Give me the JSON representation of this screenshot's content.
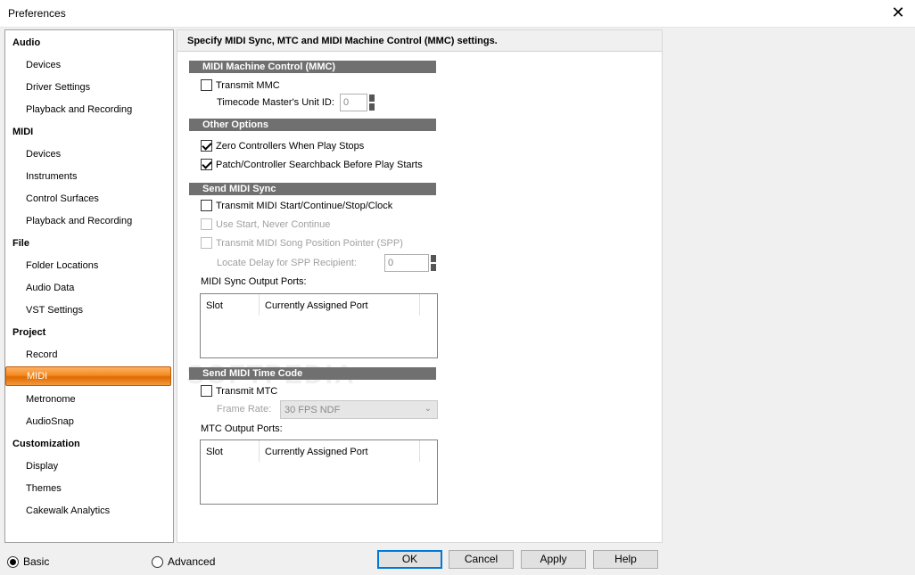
{
  "window": {
    "title": "Preferences",
    "close_glyph": "✕"
  },
  "sidebar": {
    "categories": [
      {
        "label": "Audio",
        "items": [
          "Devices",
          "Driver Settings",
          "Playback and Recording"
        ]
      },
      {
        "label": "MIDI",
        "items": [
          "Devices",
          "Instruments",
          "Control Surfaces",
          "Playback and Recording"
        ]
      },
      {
        "label": "File",
        "items": [
          "Folder Locations",
          "Audio Data",
          "VST Settings"
        ]
      },
      {
        "label": "Project",
        "items": [
          "Record",
          "MIDI",
          "Metronome",
          "AudioSnap"
        ]
      },
      {
        "label": "Customization",
        "items": [
          "Display",
          "Themes",
          "Cakewalk Analytics"
        ]
      }
    ],
    "active": "Project/MIDI"
  },
  "panel": {
    "header": "Specify MIDI Sync, MTC and MIDI Machine Control (MMC) settings.",
    "mmc": {
      "title": "MIDI Machine Control (MMC)",
      "transmit_mmc": {
        "label": "Transmit MMC",
        "checked": false
      },
      "unit_id_label": "Timecode Master's Unit ID:",
      "unit_id_value": "0"
    },
    "other": {
      "title": "Other Options",
      "zero_controllers": {
        "label": "Zero Controllers When Play Stops",
        "checked": true
      },
      "patch_searchback": {
        "label": "Patch/Controller Searchback Before Play Starts",
        "checked": true
      }
    },
    "sync": {
      "title": "Send MIDI Sync",
      "transmit_clock": {
        "label": "Transmit MIDI Start/Continue/Stop/Clock",
        "checked": false
      },
      "use_start": {
        "label": "Use Start, Never Continue",
        "checked": false
      },
      "transmit_spp": {
        "label": "Transmit MIDI Song Position Pointer (SPP)",
        "checked": false
      },
      "locate_delay_label": "Locate Delay for SPP Recipient:",
      "locate_delay_value": "0",
      "ports_label": "MIDI Sync Output Ports:",
      "columns": [
        "Slot",
        "Currently Assigned Port"
      ]
    },
    "mtc": {
      "title": "Send MIDI Time Code",
      "transmit_mtc": {
        "label": "Transmit MTC",
        "checked": false
      },
      "frame_rate_label": "Frame Rate:",
      "frame_rate_value": "30 FPS NDF",
      "ports_label": "MTC Output Ports:",
      "columns": [
        "Slot",
        "Currently Assigned Port"
      ]
    },
    "watermark": "SOFTPEDIA"
  },
  "footer": {
    "basic": "Basic",
    "advanced": "Advanced",
    "mode": "Basic",
    "ok": "OK",
    "cancel": "Cancel",
    "apply": "Apply",
    "help": "Help"
  }
}
